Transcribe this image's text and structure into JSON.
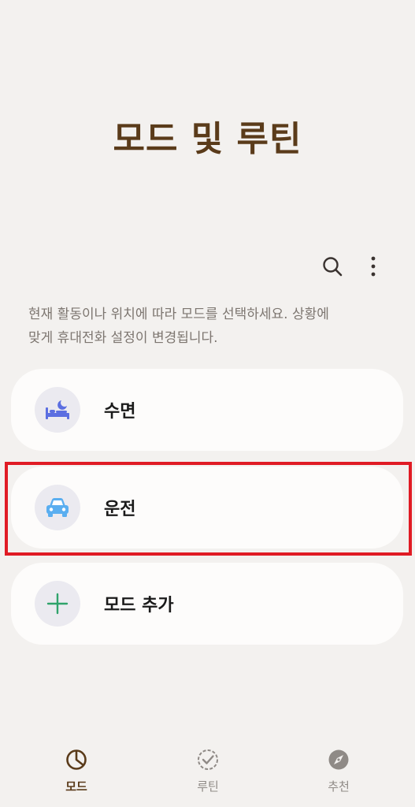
{
  "header": {
    "title": "모드 및 루틴"
  },
  "toolbar": {
    "search_icon": "search-icon",
    "more_icon": "more-vertical-icon"
  },
  "description": {
    "line1": "현재 활동이나 위치에 따라 모드를 선택하세요. 상황에",
    "line2": "맞게 휴대전화 설정이 변경됩니다."
  },
  "modes": [
    {
      "label": "수면",
      "icon": "bed-icon",
      "icon_color": "#5b6ee1"
    },
    {
      "label": "운전",
      "icon": "car-icon",
      "icon_color": "#5aaef0"
    },
    {
      "label": "모드 추가",
      "icon": "plus-icon",
      "icon_color": "#2fa36b"
    }
  ],
  "bottom_nav": {
    "items": [
      {
        "label": "모드",
        "icon": "pie-chart-icon",
        "active": true
      },
      {
        "label": "루틴",
        "icon": "check-circle-icon",
        "active": false
      },
      {
        "label": "추천",
        "icon": "compass-icon",
        "active": false
      }
    ]
  },
  "colors": {
    "background": "#f3f1ef",
    "title": "#5a3b1a",
    "highlight": "#e01b24"
  }
}
